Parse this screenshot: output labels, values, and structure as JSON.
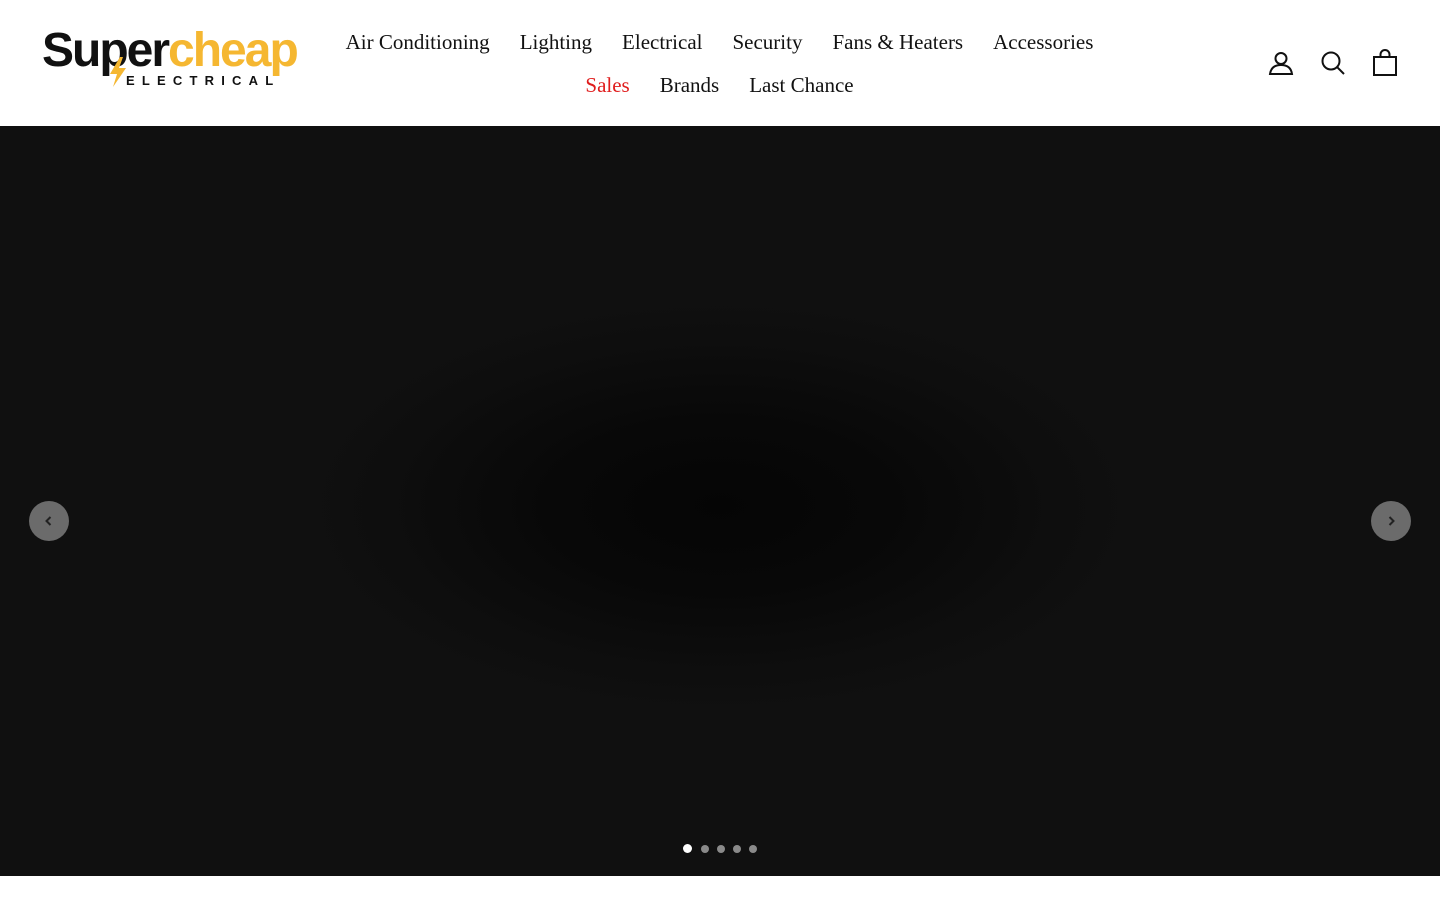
{
  "brand": {
    "logo_text_dark": "Super",
    "logo_text_accent": "cheap",
    "logo_sub": "ELECTRICAL",
    "accent_color": "#f5b731",
    "dark_color": "#111111"
  },
  "nav": {
    "items": [
      {
        "label": "Air Conditioning"
      },
      {
        "label": "Lighting"
      },
      {
        "label": "Electrical"
      },
      {
        "label": "Security"
      },
      {
        "label": "Fans & Heaters"
      },
      {
        "label": "Accessories"
      },
      {
        "label": "Sales",
        "color": "#e01d1d"
      },
      {
        "label": "Brands"
      },
      {
        "label": "Last Chance"
      }
    ]
  },
  "header_icons": {
    "account": "user-icon",
    "search": "search-icon",
    "cart": "bag-icon"
  },
  "hero": {
    "background_color": "#101010",
    "prev_icon": "chevron-left-icon",
    "next_icon": "chevron-right-icon",
    "slide_count": 5,
    "active_slide": 1
  }
}
